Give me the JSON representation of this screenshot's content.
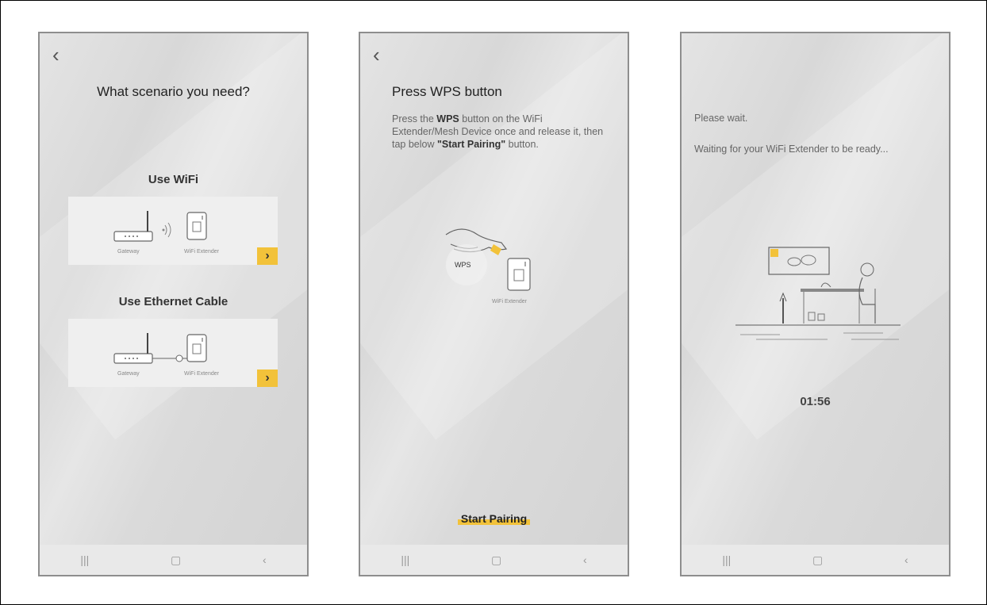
{
  "screens": [
    {
      "title": "What scenario you need?",
      "options": [
        {
          "label": "Use WiFi",
          "left_device": "Gateway",
          "right_device": "WiFi Extender"
        },
        {
          "label": "Use Ethernet Cable",
          "left_device": "Gateway",
          "right_device": "WiFi Extender"
        }
      ]
    },
    {
      "title": "Press WPS button",
      "desc_part1": "Press the ",
      "desc_bold1": "WPS",
      "desc_part2": " button on the WiFi Extender/Mesh Device once and release it, then tap below ",
      "desc_bold2": "\"Start Pairing\"",
      "desc_part3": " button.",
      "wps_label": "WPS",
      "device_caption": "WiFi Extender",
      "button_label": "Start Pairing"
    },
    {
      "line1": "Please wait.",
      "line2": "Waiting for your WiFi Extender to be ready...",
      "timer": "01:56"
    }
  ],
  "icons": {
    "back": "back-chevron-icon",
    "nav_recent": "recent-apps-icon",
    "nav_home": "home-icon",
    "nav_back": "nav-back-icon"
  },
  "accent": "#f2c23a"
}
